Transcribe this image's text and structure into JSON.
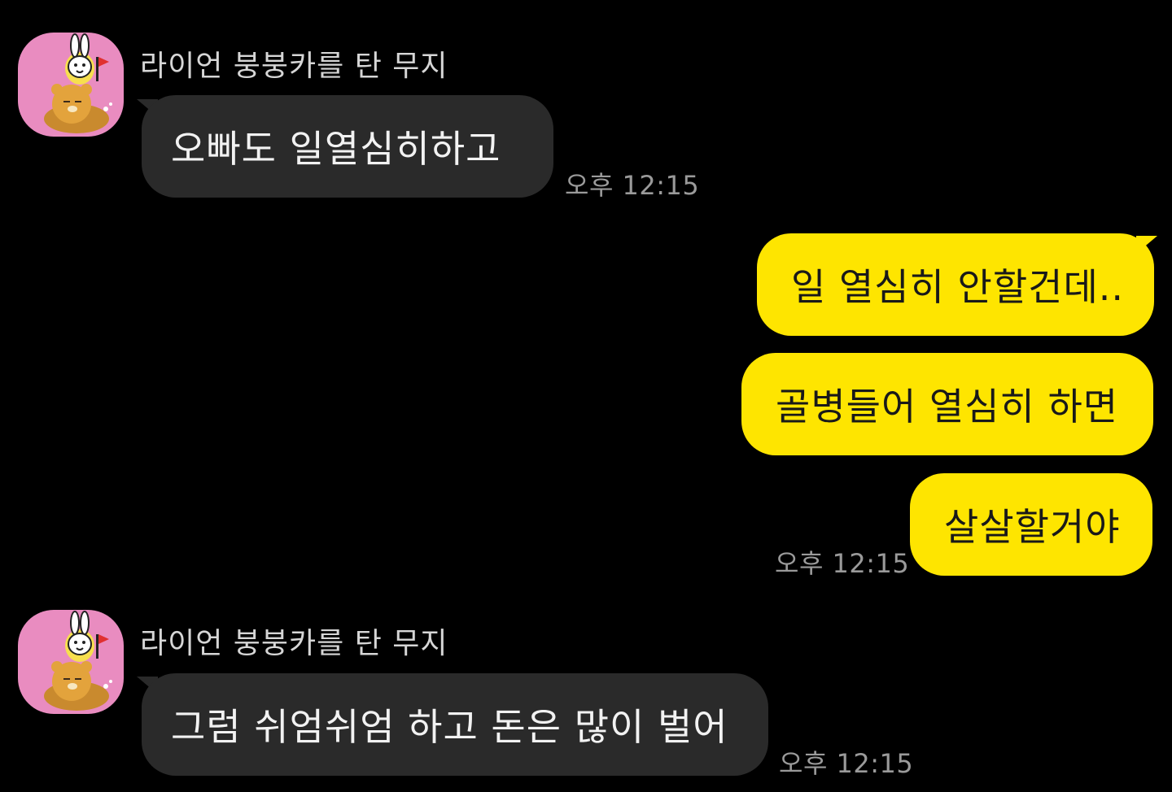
{
  "chat": {
    "sender_name": "라이언 붕붕카를 탄 무지",
    "messages": [
      {
        "text": "오빠도 일열심히하고",
        "time": "오후 12:15"
      },
      {
        "text": "일 열심히 안할건데.."
      },
      {
        "text": "골병들어 열심히 하면"
      },
      {
        "text": "살살할거야",
        "time": "오후 12:15"
      },
      {
        "text": "그럼 쉬엄쉬엄 하고 돈은 많이 벌어",
        "time": "오후 12:15"
      }
    ]
  },
  "colors": {
    "background": "#000000",
    "incoming_bubble": "#2a2a2a",
    "outgoing_bubble": "#fee500",
    "avatar_bg": "#e98cc0"
  },
  "icons": {
    "avatar": "muzi-riding-ryan-car-avatar"
  }
}
